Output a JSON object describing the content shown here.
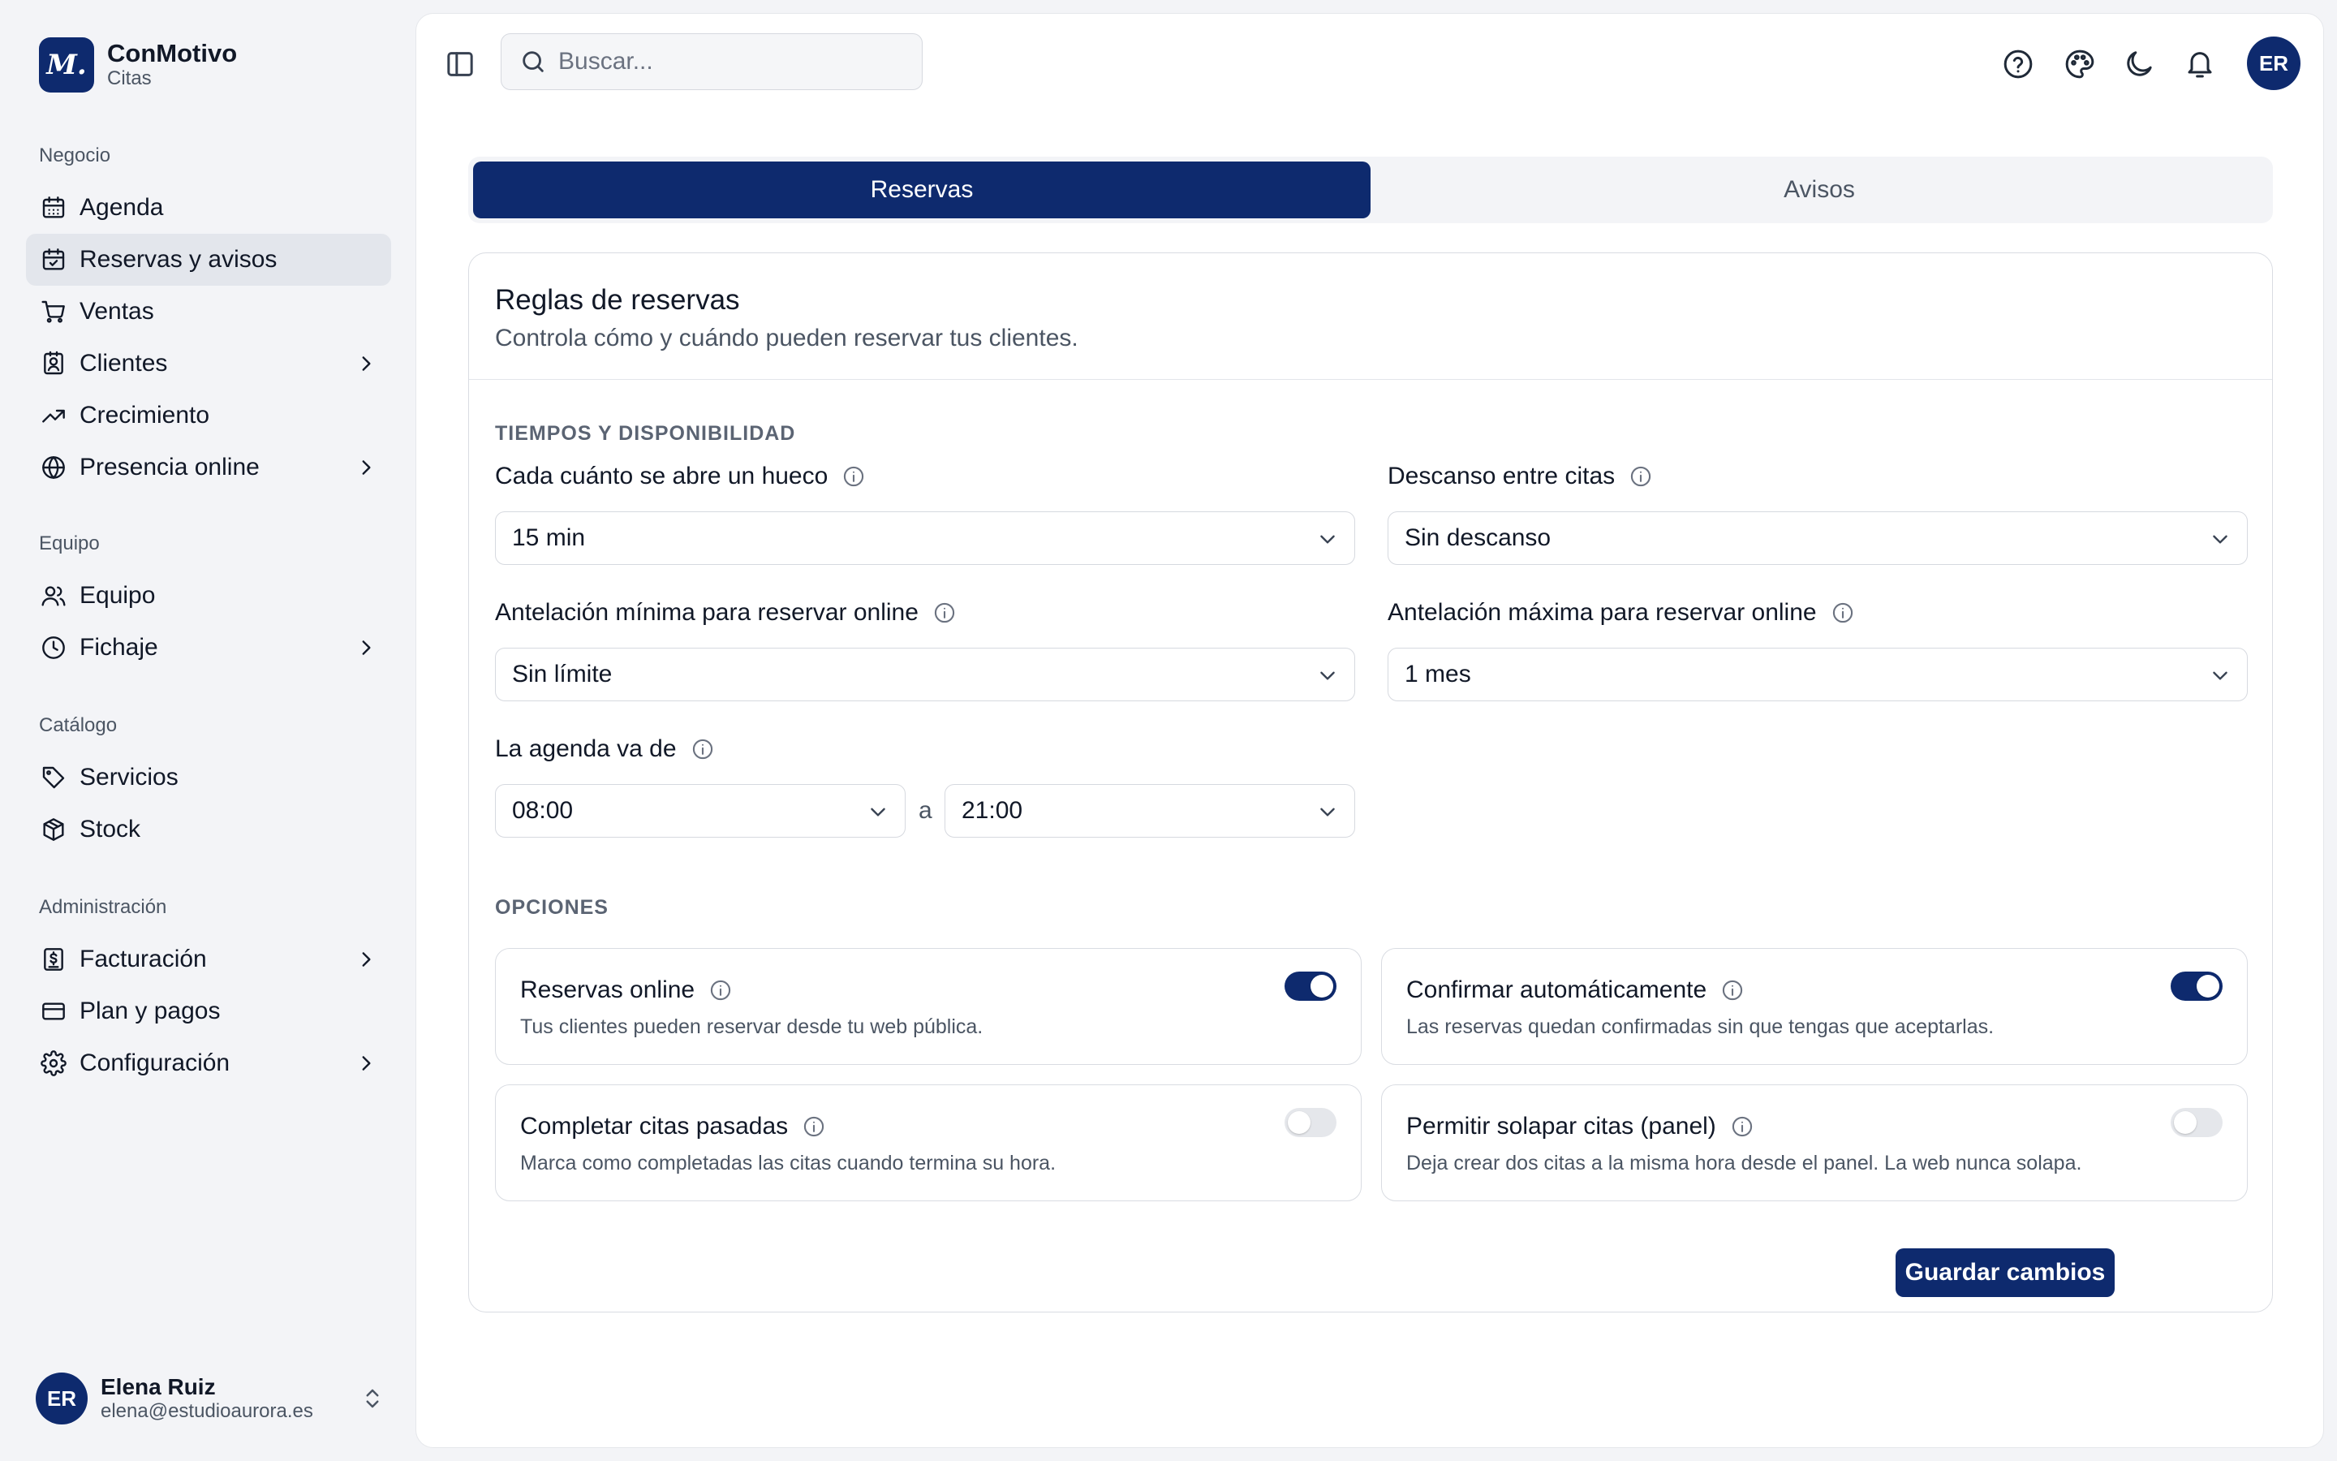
{
  "brand": {
    "logo_text": "M.",
    "name": "ConMotivo",
    "subtitle": "Citas"
  },
  "sidebar": {
    "sections": [
      {
        "heading": "Negocio",
        "items": [
          {
            "label": "Agenda",
            "icon": "calendar-icon",
            "active": false,
            "has_children": false
          },
          {
            "label": "Reservas y avisos",
            "icon": "calendar-check-icon",
            "active": true,
            "has_children": false
          },
          {
            "label": "Ventas",
            "icon": "cart-icon",
            "active": false,
            "has_children": false
          },
          {
            "label": "Clientes",
            "icon": "contacts-icon",
            "active": false,
            "has_children": true
          },
          {
            "label": "Crecimiento",
            "icon": "trending-up-icon",
            "active": false,
            "has_children": false
          },
          {
            "label": "Presencia online",
            "icon": "globe-icon",
            "active": false,
            "has_children": true
          }
        ]
      },
      {
        "heading": "Equipo",
        "items": [
          {
            "label": "Equipo",
            "icon": "users-icon",
            "active": false,
            "has_children": false
          },
          {
            "label": "Fichaje",
            "icon": "clock-icon",
            "active": false,
            "has_children": true
          }
        ]
      },
      {
        "heading": "Catálogo",
        "items": [
          {
            "label": "Servicios",
            "icon": "tag-icon",
            "active": false,
            "has_children": false
          },
          {
            "label": "Stock",
            "icon": "package-icon",
            "active": false,
            "has_children": false
          }
        ]
      },
      {
        "heading": "Administración",
        "items": [
          {
            "label": "Facturación",
            "icon": "invoice-icon",
            "active": false,
            "has_children": true
          },
          {
            "label": "Plan y pagos",
            "icon": "credit-card-icon",
            "active": false,
            "has_children": false
          },
          {
            "label": "Configuración",
            "icon": "gear-icon",
            "active": false,
            "has_children": true
          }
        ]
      }
    ]
  },
  "user": {
    "initials": "ER",
    "name": "Elena Ruiz",
    "email": "elena@estudioaurora.es"
  },
  "topbar": {
    "search_placeholder": "Buscar...",
    "avatar_initials": "ER"
  },
  "tabs": [
    {
      "label": "Reservas",
      "active": true
    },
    {
      "label": "Avisos",
      "active": false
    }
  ],
  "card": {
    "title": "Reglas de reservas",
    "subtitle": "Controla cómo y cuándo pueden reservar tus clientes.",
    "section_times": "TIEMPOS Y DISPONIBILIDAD",
    "fields": {
      "slot_interval": {
        "label": "Cada cuánto se abre un hueco",
        "value": "15 min"
      },
      "break_between": {
        "label": "Descanso entre citas",
        "value": "Sin descanso"
      },
      "min_advance": {
        "label": "Antelación mínima para reservar online",
        "value": "Sin límite"
      },
      "max_advance": {
        "label": "Antelación máxima para reservar online",
        "value": "1 mes"
      },
      "agenda_range": {
        "label": "La agenda va de",
        "from": "08:00",
        "separator": "a",
        "to": "21:00"
      }
    },
    "section_options": "OPCIONES",
    "options": [
      {
        "title": "Reservas online",
        "description": "Tus clientes pueden reservar desde tu web pública.",
        "enabled": true
      },
      {
        "title": "Confirmar automáticamente",
        "description": "Las reservas quedan confirmadas sin que tengas que aceptarlas.",
        "enabled": true
      },
      {
        "title": "Completar citas pasadas",
        "description": "Marca como completadas las citas cuando termina su hora.",
        "enabled": false
      },
      {
        "title": "Permitir solapar citas (panel)",
        "description": "Deja crear dos citas a la misma hora desde el panel. La web nunca solapa.",
        "enabled": false
      }
    ],
    "save_label": "Guardar cambios"
  },
  "colors": {
    "brand": "#0e2a6e",
    "background": "#f3f4f7",
    "active_nav": "#e3e6ec"
  }
}
